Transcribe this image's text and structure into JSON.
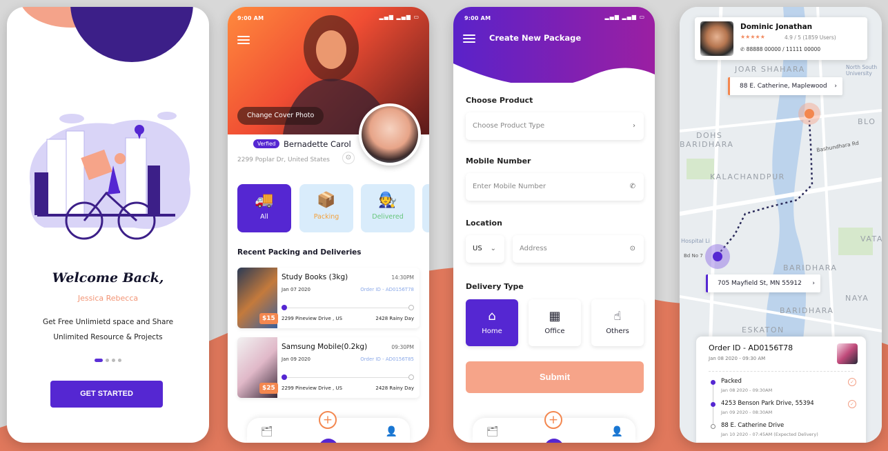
{
  "colors": {
    "primary": "#5527d2",
    "accent": "#f3874f",
    "salmon": "#f6a489"
  },
  "p1": {
    "title": "Welcome Back,",
    "subtitle": "Jessica Rebecca",
    "tagline1": "Get Free Unlimietd space and Share",
    "tagline2": "Unlimited Resource & Projects",
    "button": "GET STARTED"
  },
  "p2": {
    "time": "9:00 AM",
    "change_cover": "Change Cover Photo",
    "verified": "Verfied",
    "name": "Bernadette Carol",
    "address": "2299 Poplar Dr, United States",
    "categories": [
      {
        "label": "All",
        "icon": "truck-icon"
      },
      {
        "label": "Packing",
        "icon": "box-icon"
      },
      {
        "label": "Delivered",
        "icon": "delivery-man-icon"
      }
    ],
    "section_title": "Recent Packing and Deliveries",
    "items": [
      {
        "name": "Study Books (3kg)",
        "time": "14:30PM",
        "date": "Jan 07 2020",
        "order": "Order ID - AD0156T78",
        "from": "2299 Pineview Drive , US",
        "to": "2428 Rainy Day",
        "price": "$15"
      },
      {
        "name": "Samsung Mobile(0.2kg)",
        "time": "09:30PM",
        "date": "Jan 09 2020",
        "order": "Order ID - AD0156T85",
        "from": "2299 Pineview Drive , US",
        "to": "2428 Rainy Day",
        "price": "$25"
      }
    ]
  },
  "p3": {
    "time": "9:00 AM",
    "title": "Create New Package",
    "product_label": "Choose Product",
    "product_placeholder": "Choose Product Type",
    "mobile_label": "Mobile Number",
    "mobile_placeholder": "Enter Mobile Number",
    "location_label": "Location",
    "country": "US",
    "address_placeholder": "Address",
    "delivery_label": "Delivery Type",
    "delivery_types": [
      {
        "label": "Home",
        "icon": "home-icon"
      },
      {
        "label": "Office",
        "icon": "building-icon"
      },
      {
        "label": "Others",
        "icon": "hand-icon"
      }
    ],
    "submit": "Submit"
  },
  "p4": {
    "user_name": "Dominic Jonathan",
    "stars": "★★★★★",
    "rating": "4.9 / 5  (1859 Users)",
    "phone": "88888 00000 / 11111 00000",
    "dest_address": "88 E. Catherine, Maplewood",
    "origin_address": "705 Mayfield St, MN 55912",
    "map_labels": {
      "joar": "JOAR SHAHARA",
      "dohs": "DOHS",
      "baridhara": "BARIDHARA",
      "kalachandpur": "KALACHANDPUR",
      "baridhara2": "BARIDHARA",
      "baridhara3": "BARIDHARA",
      "naya": "NAYA",
      "eskaton": "ESKATON",
      "north": "North South University",
      "bashundhara": "Bashundhara Rd",
      "hospital": "Hospital Li",
      "blo": "BLO",
      "vata": "VATA",
      "bd": "Bd No 7"
    },
    "order_id": "Order ID - AD0156T78",
    "order_date": "Jan 08 2020  -  09:30 AM",
    "steps": [
      {
        "title": "Packed",
        "date": "Jan 08 2020 - 09:30AM"
      },
      {
        "title": "4253  Benson Park Drive, 55394",
        "date": "Jan 09 2020 - 08:30AM"
      },
      {
        "title": "88 E. Catherine Drive",
        "date": "Jan 10 2020 - 07:45AM (Expected Delivery)"
      }
    ]
  }
}
